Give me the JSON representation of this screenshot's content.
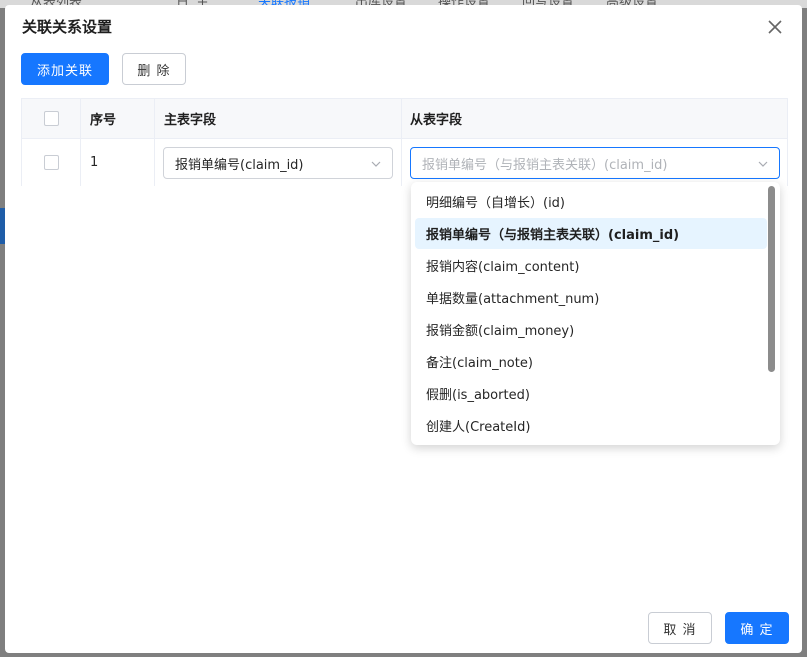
{
  "background": {
    "tabs": [
      "从表列表",
      "日",
      "主",
      "关联报销",
      "出库设置",
      "操作设置",
      "回写设置",
      "高级设置"
    ]
  },
  "dialog": {
    "title": "关联关系设置",
    "toolbar": {
      "add_label": "添加关联",
      "delete_label": "删 除"
    },
    "table": {
      "headers": {
        "seq": "序号",
        "main_field": "主表字段",
        "sub_field": "从表字段"
      },
      "rows": [
        {
          "seq": "1",
          "main_field_value": "报销单编号(claim_id)",
          "sub_field_placeholder": "报销单编号（与报销主表关联）(claim_id)"
        }
      ]
    },
    "dropdown": {
      "options": [
        "明细编号（自增长）(id)",
        "报销单编号（与报销主表关联）(claim_id)",
        "报销内容(claim_content)",
        "单据数量(attachment_num)",
        "报销金额(claim_money)",
        "备注(claim_note)",
        "假删(is_aborted)",
        "创建人(CreateId)"
      ],
      "selected_index": 1
    },
    "footer": {
      "cancel_label": "取 消",
      "ok_label": "确 定"
    }
  },
  "colors": {
    "primary": "#1677ff",
    "selected_bg": "#e6f4ff",
    "border": "#ebeef5"
  }
}
